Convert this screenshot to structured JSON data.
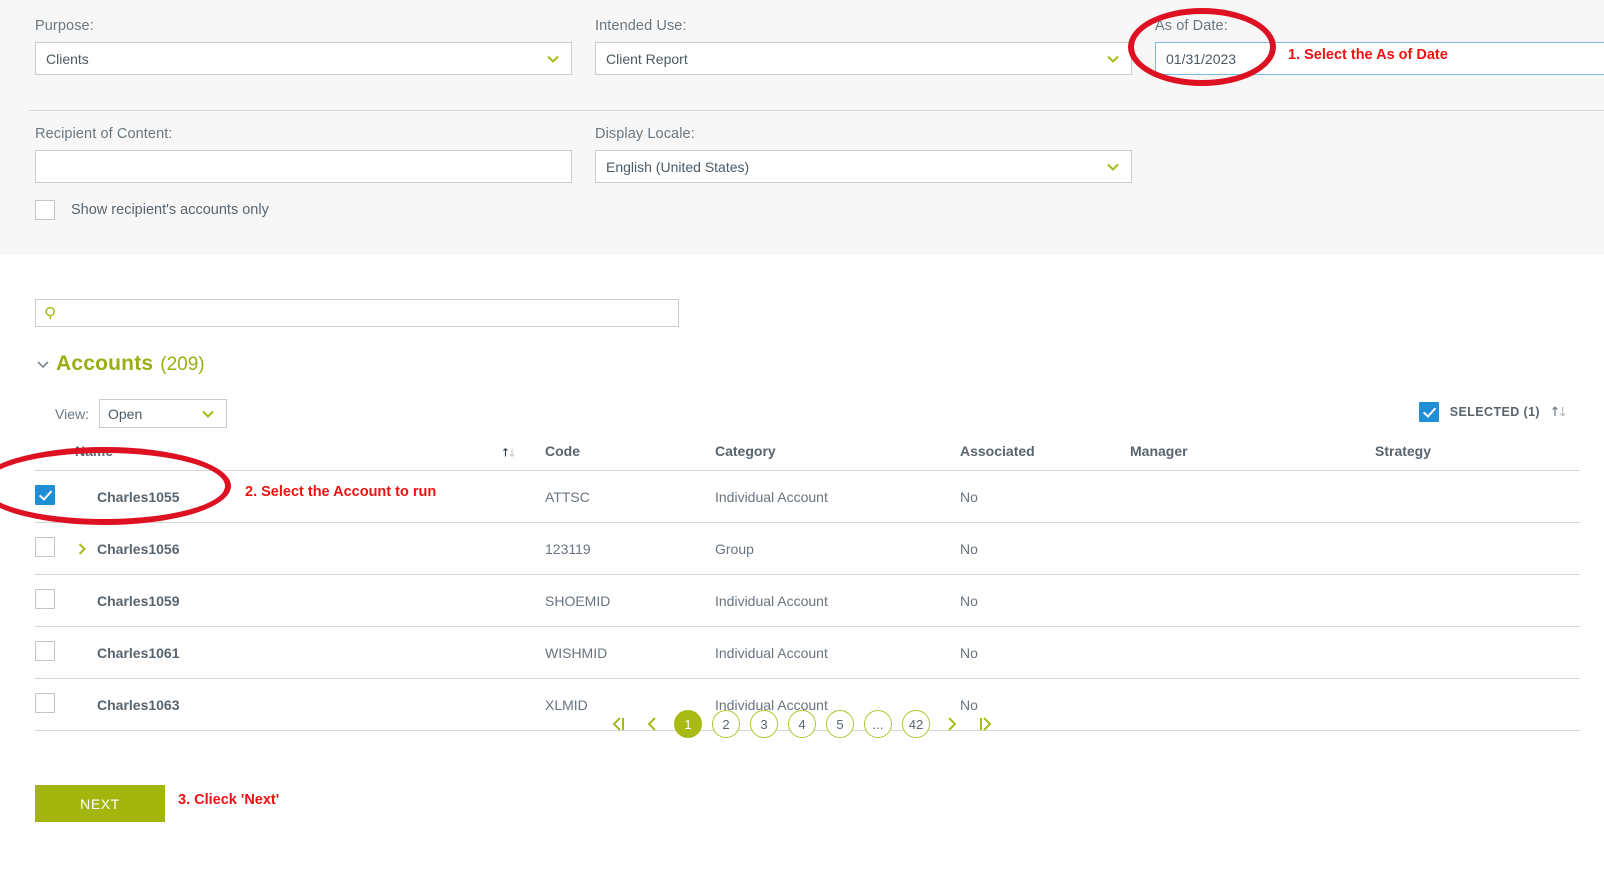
{
  "colors": {
    "olive": "#a3b60d",
    "olive_text": "#9aae12",
    "blue_check": "#1f8ed6",
    "annotation_red": "#ee1111",
    "panel_bg": "#f7f7f7"
  },
  "criteria": {
    "purpose": {
      "label": "Purpose:",
      "value": "Clients",
      "icon": "chevron-down-icon"
    },
    "intended_use": {
      "label": "Intended Use:",
      "value": "Client Report",
      "icon": "chevron-down-icon"
    },
    "as_of_date": {
      "label": "As of Date:",
      "value": "01/31/2023"
    },
    "recipient": {
      "label": "Recipient of Content:",
      "value": "",
      "placeholder": ""
    },
    "display_locale": {
      "label": "Display Locale:",
      "value": "English (United States)",
      "icon": "chevron-down-icon"
    },
    "show_recipient_accounts": {
      "label": "Show recipient's accounts only",
      "checked": false
    }
  },
  "search": {
    "value": "",
    "placeholder": "",
    "icon": "search-icon"
  },
  "accounts": {
    "caret_icon": "chevron-down-icon",
    "title": "Accounts",
    "count": "(209)",
    "view": {
      "label": "View:",
      "value": "Open",
      "icon": "chevron-down-icon"
    },
    "selected": {
      "label": "SELECTED (1)",
      "checked": true,
      "sort_icon": "sort-updown-icon"
    },
    "columns": [
      {
        "key": "name",
        "label": "Name",
        "sorted": true,
        "sort_icon": "sort-updown-icon"
      },
      {
        "key": "code",
        "label": "Code",
        "sorted": false
      },
      {
        "key": "category",
        "label": "Category",
        "sorted": false
      },
      {
        "key": "assoc",
        "label": "Associated",
        "sorted": false
      },
      {
        "key": "manager",
        "label": "Manager",
        "sorted": false
      },
      {
        "key": "strategy",
        "label": "Strategy",
        "sorted": false
      }
    ],
    "rows": [
      {
        "checked": true,
        "expandable": false,
        "name": "Charles1055",
        "code": "ATTSC",
        "category": "Individual Account",
        "assoc": "No",
        "manager": "",
        "strategy": ""
      },
      {
        "checked": false,
        "expandable": true,
        "name": "Charles1056",
        "code": "123119",
        "category": "Group",
        "assoc": "No",
        "manager": "",
        "strategy": ""
      },
      {
        "checked": false,
        "expandable": false,
        "name": "Charles1059",
        "code": "SHOEMID",
        "category": "Individual Account",
        "assoc": "No",
        "manager": "",
        "strategy": ""
      },
      {
        "checked": false,
        "expandable": false,
        "name": "Charles1061",
        "code": "WISHMID",
        "category": "Individual Account",
        "assoc": "No",
        "manager": "",
        "strategy": ""
      },
      {
        "checked": false,
        "expandable": false,
        "name": "Charles1063",
        "code": "XLMID",
        "category": "Individual Account",
        "assoc": "No",
        "manager": "",
        "strategy": ""
      }
    ]
  },
  "pagination": {
    "first_icon": "first-page-icon",
    "prev_icon": "prev-page-icon",
    "next_icon": "next-page-icon",
    "last_icon": "last-page-icon",
    "pages": [
      {
        "label": "1",
        "active": true
      },
      {
        "label": "2",
        "active": false
      },
      {
        "label": "3",
        "active": false
      },
      {
        "label": "4",
        "active": false
      },
      {
        "label": "5",
        "active": false
      },
      {
        "label": "...",
        "active": false
      },
      {
        "label": "42",
        "active": false
      }
    ]
  },
  "footer": {
    "next_label": "NEXT"
  },
  "annotations": [
    {
      "id": 1,
      "text": "1. Select the As of Date"
    },
    {
      "id": 2,
      "text": "2. Select the Account to run"
    },
    {
      "id": 3,
      "text": "3. Clieck 'Next'"
    }
  ]
}
